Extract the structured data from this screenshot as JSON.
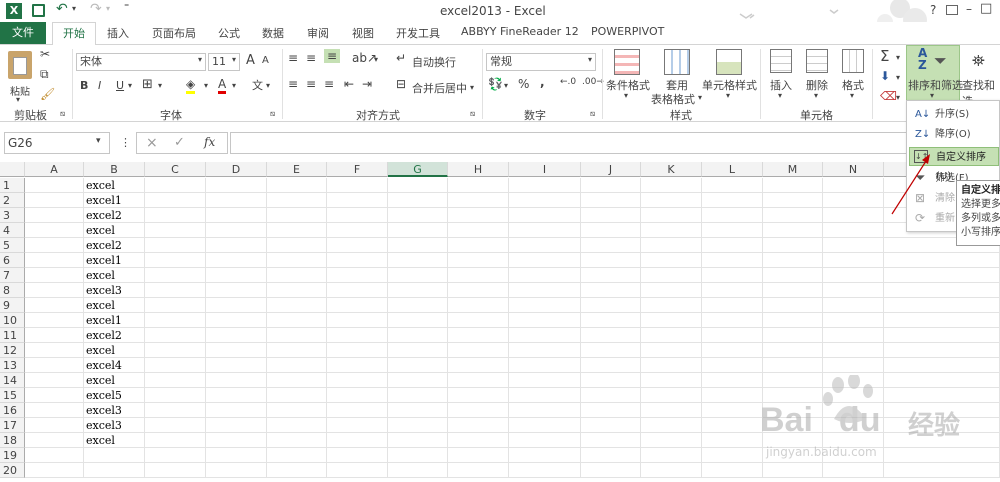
{
  "window": {
    "title": "excel2013 - Excel",
    "help": "?",
    "controls": [
      "–",
      "□",
      "×"
    ]
  },
  "tabs": [
    "文件",
    "开始",
    "插入",
    "页面布局",
    "公式",
    "数据",
    "审阅",
    "视图",
    "开发工具",
    "ABBYY FineReader 12",
    "POWERPIVOT"
  ],
  "ribbon": {
    "clipboard": {
      "paste": "粘贴",
      "label": "剪贴板"
    },
    "font": {
      "name": "宋体",
      "size": "11",
      "label": "字体",
      "bold": "B",
      "italic": "I",
      "underline": "U",
      "grow": "A",
      "shrink": "A"
    },
    "alignment": {
      "wrap": "自动换行",
      "merge": "合并后居中",
      "label": "对齐方式"
    },
    "number": {
      "format": "常规",
      "label": "数字",
      "percent": "%",
      "comma": ","
    },
    "styles": {
      "conditional": "条件格式",
      "table_line1": "套用",
      "table_line2": "表格格式",
      "cell_styles": "单元格样式",
      "label": "样式"
    },
    "cells": {
      "insert": "插入",
      "delete": "删除",
      "format": "格式",
      "label": "单元格"
    },
    "editing": {
      "sort_filter": "排序和筛选",
      "find": "查找和选"
    }
  },
  "formula_bar": {
    "name_box": "G26",
    "cancel": "×",
    "enter": "✓",
    "fx": "fx",
    "value": ""
  },
  "sheet": {
    "columns": [
      "A",
      "B",
      "C",
      "D",
      "E",
      "F",
      "G",
      "H",
      "I",
      "J",
      "K",
      "L",
      "M",
      "N"
    ],
    "selected_column": "G",
    "rows": [
      "1",
      "2",
      "3",
      "4",
      "5",
      "6",
      "7",
      "8",
      "9",
      "10",
      "11",
      "12",
      "13",
      "14",
      "15",
      "16",
      "17",
      "18",
      "19",
      "20"
    ],
    "b_values": [
      "excel",
      "excel1",
      "excel2",
      "excel",
      "excel2",
      "excel1",
      "excel",
      "excel3",
      "excel",
      "excel1",
      "excel2",
      "excel",
      "excel4",
      "excel",
      "excel5",
      "excel3",
      "excel3",
      "excel",
      "",
      ""
    ]
  },
  "dropdown": {
    "items": [
      "升序(S)",
      "降序(O)",
      "自定义排序(U)",
      "筛选(F)",
      "清除",
      "重新"
    ],
    "highlighted": "自定义排序(U)"
  },
  "tooltip": {
    "title": "自定义排",
    "line1": "选择更多",
    "line2": "多列或多",
    "line3": "小写排序"
  },
  "watermark": {
    "brand": "Bai",
    "brand2": "du",
    "cn": "经验",
    "url": "jingyan.baidu.com"
  },
  "colors": {
    "accent": "#217346",
    "selected": "#d2e3d9"
  }
}
